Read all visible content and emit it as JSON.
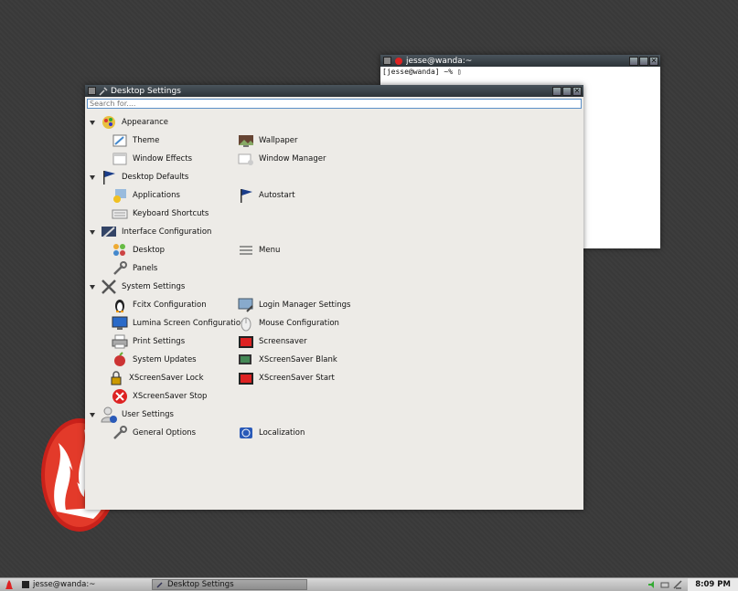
{
  "terminal": {
    "title": "jesse@wanda:~",
    "prompt": "[jesse@wanda] ~% ▯"
  },
  "settings": {
    "title": "Desktop Settings",
    "search_placeholder": "Search for....",
    "categories": [
      {
        "label": "Appearance",
        "items": [
          "Theme",
          "Wallpaper",
          "Window Effects",
          "Window Manager"
        ]
      },
      {
        "label": "Desktop Defaults",
        "items": [
          "Applications",
          "Autostart",
          "Keyboard Shortcuts"
        ]
      },
      {
        "label": "Interface Configuration",
        "items": [
          "Desktop",
          "Menu",
          "Panels"
        ]
      },
      {
        "label": "System Settings",
        "items": [
          "Fcitx Configuration",
          "Login Manager Settings",
          "Lumina Screen Configuration",
          "Mouse Configuration",
          "Print Settings",
          "Screensaver",
          "System Updates",
          "XScreenSaver Blank",
          "XScreenSaver Lock",
          "XScreenSaver Start",
          "XScreenSaver Stop"
        ]
      },
      {
        "label": "User Settings",
        "items": [
          "General Options",
          "Localization"
        ]
      }
    ]
  },
  "taskbar": {
    "tasks": [
      "jesse@wanda:~",
      "Desktop Settings"
    ],
    "clock": "8:09 PM"
  }
}
